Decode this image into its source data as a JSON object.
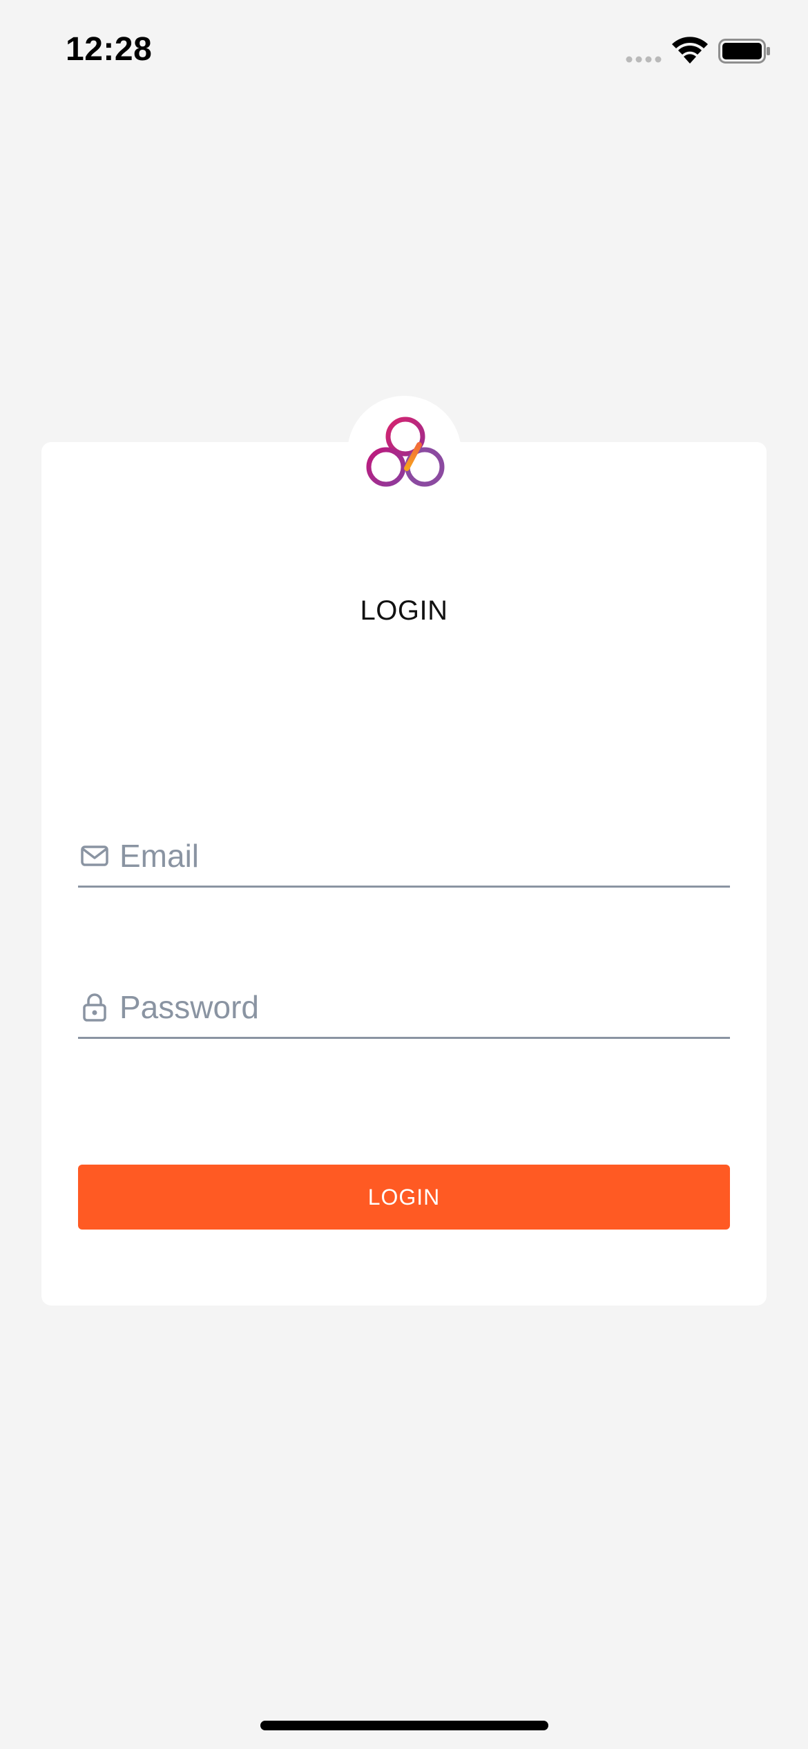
{
  "status_bar": {
    "time": "12:28"
  },
  "login_card": {
    "title": "LOGIN",
    "email": {
      "placeholder": "Email",
      "value": "",
      "icon": "mail-icon"
    },
    "password": {
      "placeholder": "Password",
      "value": "",
      "icon": "lock-icon"
    },
    "button_label": "LOGIN"
  },
  "colors": {
    "background": "#f4f4f4",
    "card": "#ffffff",
    "accent": "#ff5a23",
    "field_line": "#8a94a2",
    "logo_gradient": [
      "#c0187a",
      "#f7941d",
      "#8b3d9e"
    ]
  }
}
